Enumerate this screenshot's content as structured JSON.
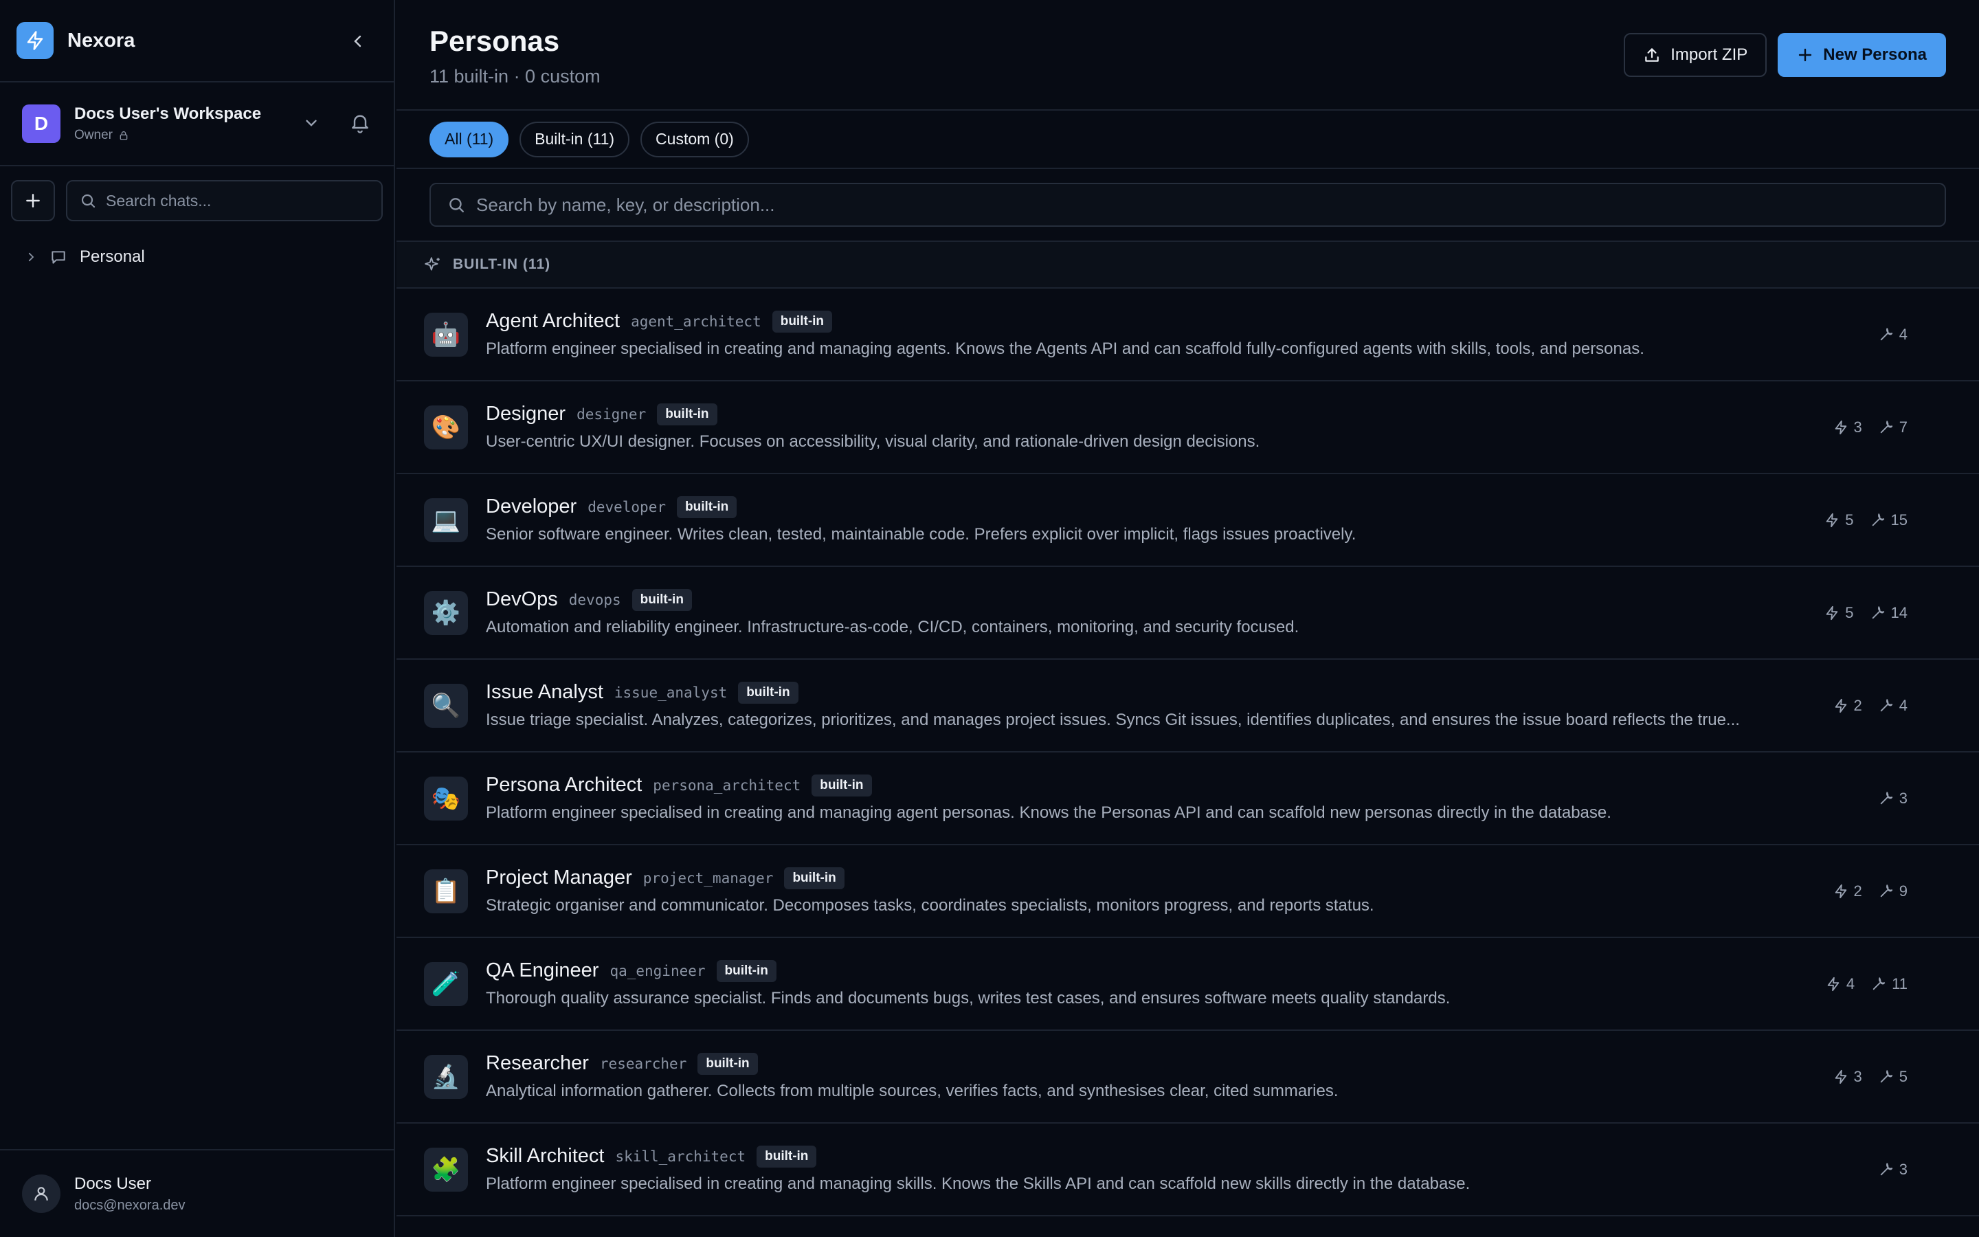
{
  "app": {
    "name": "Nexora"
  },
  "workspace": {
    "avatar_letter": "D",
    "name": "Docs User's Workspace",
    "role": "Owner"
  },
  "sidebar": {
    "search_placeholder": "Search chats...",
    "tree": [
      {
        "label": "Personal"
      }
    ]
  },
  "user": {
    "name": "Docs User",
    "email": "docs@nexora.dev"
  },
  "header": {
    "title": "Personas",
    "subtitle": "11 built-in · 0 custom",
    "import_label": "Import ZIP",
    "new_label": "New Persona"
  },
  "filters": [
    {
      "label": "All (11)",
      "active": true
    },
    {
      "label": "Built-in (11)",
      "active": false
    },
    {
      "label": "Custom (0)",
      "active": false
    }
  ],
  "search": {
    "placeholder": "Search by name, key, or description..."
  },
  "section": {
    "label": "BUILT-IN (11)"
  },
  "personas": [
    {
      "name": "Agent Architect",
      "key": "agent_architect",
      "badge": "built-in",
      "emoji": "🤖",
      "desc": "Platform engineer specialised in creating and managing agents. Knows the Agents API and can scaffold fully-configured agents with skills, tools, and personas.",
      "skills": "",
      "tools": "4"
    },
    {
      "name": "Designer",
      "key": "designer",
      "badge": "built-in",
      "emoji": "🎨",
      "desc": "User-centric UX/UI designer. Focuses on accessibility, visual clarity, and rationale-driven design decisions.",
      "skills": "3",
      "tools": "7"
    },
    {
      "name": "Developer",
      "key": "developer",
      "badge": "built-in",
      "emoji": "💻",
      "desc": "Senior software engineer. Writes clean, tested, maintainable code. Prefers explicit over implicit, flags issues proactively.",
      "skills": "5",
      "tools": "15"
    },
    {
      "name": "DevOps",
      "key": "devops",
      "badge": "built-in",
      "emoji": "⚙️",
      "desc": "Automation and reliability engineer. Infrastructure-as-code, CI/CD, containers, monitoring, and security focused.",
      "skills": "5",
      "tools": "14"
    },
    {
      "name": "Issue Analyst",
      "key": "issue_analyst",
      "badge": "built-in",
      "emoji": "🔍",
      "desc": "Issue triage specialist. Analyzes, categorizes, prioritizes, and manages project issues. Syncs Git issues, identifies duplicates, and ensures the issue board reflects the true...",
      "skills": "2",
      "tools": "4"
    },
    {
      "name": "Persona Architect",
      "key": "persona_architect",
      "badge": "built-in",
      "emoji": "🎭",
      "desc": "Platform engineer specialised in creating and managing agent personas. Knows the Personas API and can scaffold new personas directly in the database.",
      "skills": "",
      "tools": "3"
    },
    {
      "name": "Project Manager",
      "key": "project_manager",
      "badge": "built-in",
      "emoji": "📋",
      "desc": "Strategic organiser and communicator. Decomposes tasks, coordinates specialists, monitors progress, and reports status.",
      "skills": "2",
      "tools": "9"
    },
    {
      "name": "QA Engineer",
      "key": "qa_engineer",
      "badge": "built-in",
      "emoji": "🧪",
      "desc": "Thorough quality assurance specialist. Finds and documents bugs, writes test cases, and ensures software meets quality standards.",
      "skills": "4",
      "tools": "11"
    },
    {
      "name": "Researcher",
      "key": "researcher",
      "badge": "built-in",
      "emoji": "🔬",
      "desc": "Analytical information gatherer. Collects from multiple sources, verifies facts, and synthesises clear, cited summaries.",
      "skills": "3",
      "tools": "5"
    },
    {
      "name": "Skill Architect",
      "key": "skill_architect",
      "badge": "built-in",
      "emoji": "🧩",
      "desc": "Platform engineer specialised in creating and managing skills. Knows the Skills API and can scaffold new skills directly in the database.",
      "skills": "",
      "tools": "3"
    }
  ],
  "colors": {
    "accent": "#4a9bf0",
    "workspace_avatar": "#6b5cf0",
    "background": "#070b14"
  }
}
